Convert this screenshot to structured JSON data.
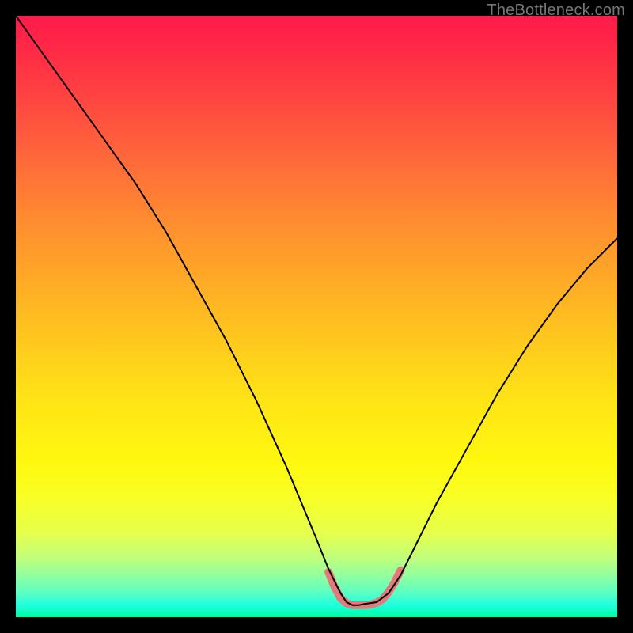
{
  "watermark": "TheBottleneck.com",
  "chart_data": {
    "type": "line",
    "title": "",
    "xlabel": "",
    "ylabel": "",
    "xlim": [
      0,
      100
    ],
    "ylim": [
      0,
      100
    ],
    "grid": false,
    "legend": false,
    "series": [
      {
        "name": "main-curve",
        "color": "#000000",
        "stroke_width": 2,
        "x": [
          0,
          5,
          10,
          15,
          20,
          25,
          30,
          35,
          40,
          45,
          50,
          52,
          54,
          55,
          56,
          57,
          58,
          60,
          62,
          64,
          66,
          70,
          75,
          80,
          85,
          90,
          95,
          100
        ],
        "y": [
          100,
          93,
          86,
          79,
          72,
          64,
          55,
          46,
          36,
          25,
          13,
          8,
          4,
          2.5,
          2,
          2,
          2.2,
          2.5,
          4,
          7,
          11,
          19,
          28,
          37,
          45,
          52,
          58,
          63
        ]
      },
      {
        "name": "bottom-highlight",
        "color": "#e47979",
        "stroke_width": 10,
        "linecap": "round",
        "x": [
          52,
          53,
          54,
          55,
          56,
          57,
          58,
          59,
          60,
          61,
          62,
          63,
          64
        ],
        "y": [
          7.5,
          5,
          3.2,
          2.3,
          2,
          2,
          2,
          2.1,
          2.4,
          3.0,
          4.2,
          5.8,
          7.8
        ]
      }
    ],
    "background_gradient": {
      "stops": [
        {
          "pos": 0,
          "color": "#ff1a4a"
        },
        {
          "pos": 50,
          "color": "#ffc81e"
        },
        {
          "pos": 80,
          "color": "#f8ff24"
        },
        {
          "pos": 100,
          "color": "#00ffa0"
        }
      ]
    }
  }
}
